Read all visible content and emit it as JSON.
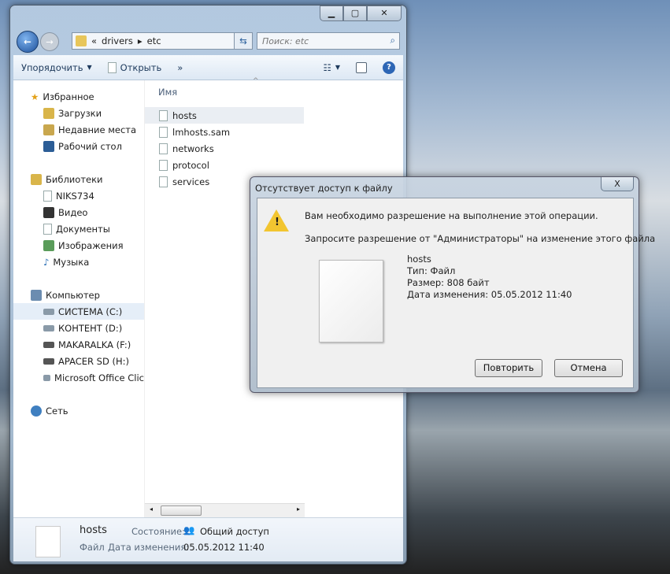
{
  "explorer": {
    "breadcrumb": [
      "«",
      "drivers",
      "etc"
    ],
    "search_placeholder": "Поиск: etc",
    "toolbar": {
      "organize": "Упорядочить",
      "open": "Открыть",
      "more": "»"
    },
    "column_header": "Имя",
    "nav": {
      "favorites": {
        "label": "Избранное",
        "items": [
          "Загрузки",
          "Недавние места",
          "Рабочий стол"
        ]
      },
      "libraries": {
        "label": "Библиотеки",
        "items": [
          "NIKS734",
          "Видео",
          "Документы",
          "Изображения",
          "Музыка"
        ]
      },
      "computer": {
        "label": "Компьютер",
        "items": [
          "СИСТЕМА (C:)",
          "КОНТЕНТ (D:)",
          "MAKARALKA (F:)",
          "APACER SD (H:)",
          "Microsoft Office Clic"
        ]
      },
      "network": {
        "label": "Сеть"
      }
    },
    "files": [
      "hosts",
      "lmhosts.sam",
      "networks",
      "protocol",
      "services"
    ],
    "details": {
      "name": "hosts",
      "type": "Файл",
      "state_label": "Состояние:",
      "state_value": "Общий доступ",
      "date_label": "Дата изменения:",
      "date_value": "05.05.2012 11:40"
    }
  },
  "dialog": {
    "title": "Отсутствует доступ к файлу",
    "close": "X",
    "message": "Вам необходимо разрешение на выполнение этой операции.",
    "request": "Запросите разрешение от \"Администраторы\" на изменение этого файла",
    "file_name": "hosts",
    "file_type": "Тип: Файл",
    "file_size": "Размер: 808 байт",
    "file_date": "Дата изменения: 05.05.2012 11:40",
    "retry": "Повторить",
    "cancel": "Отмена"
  }
}
